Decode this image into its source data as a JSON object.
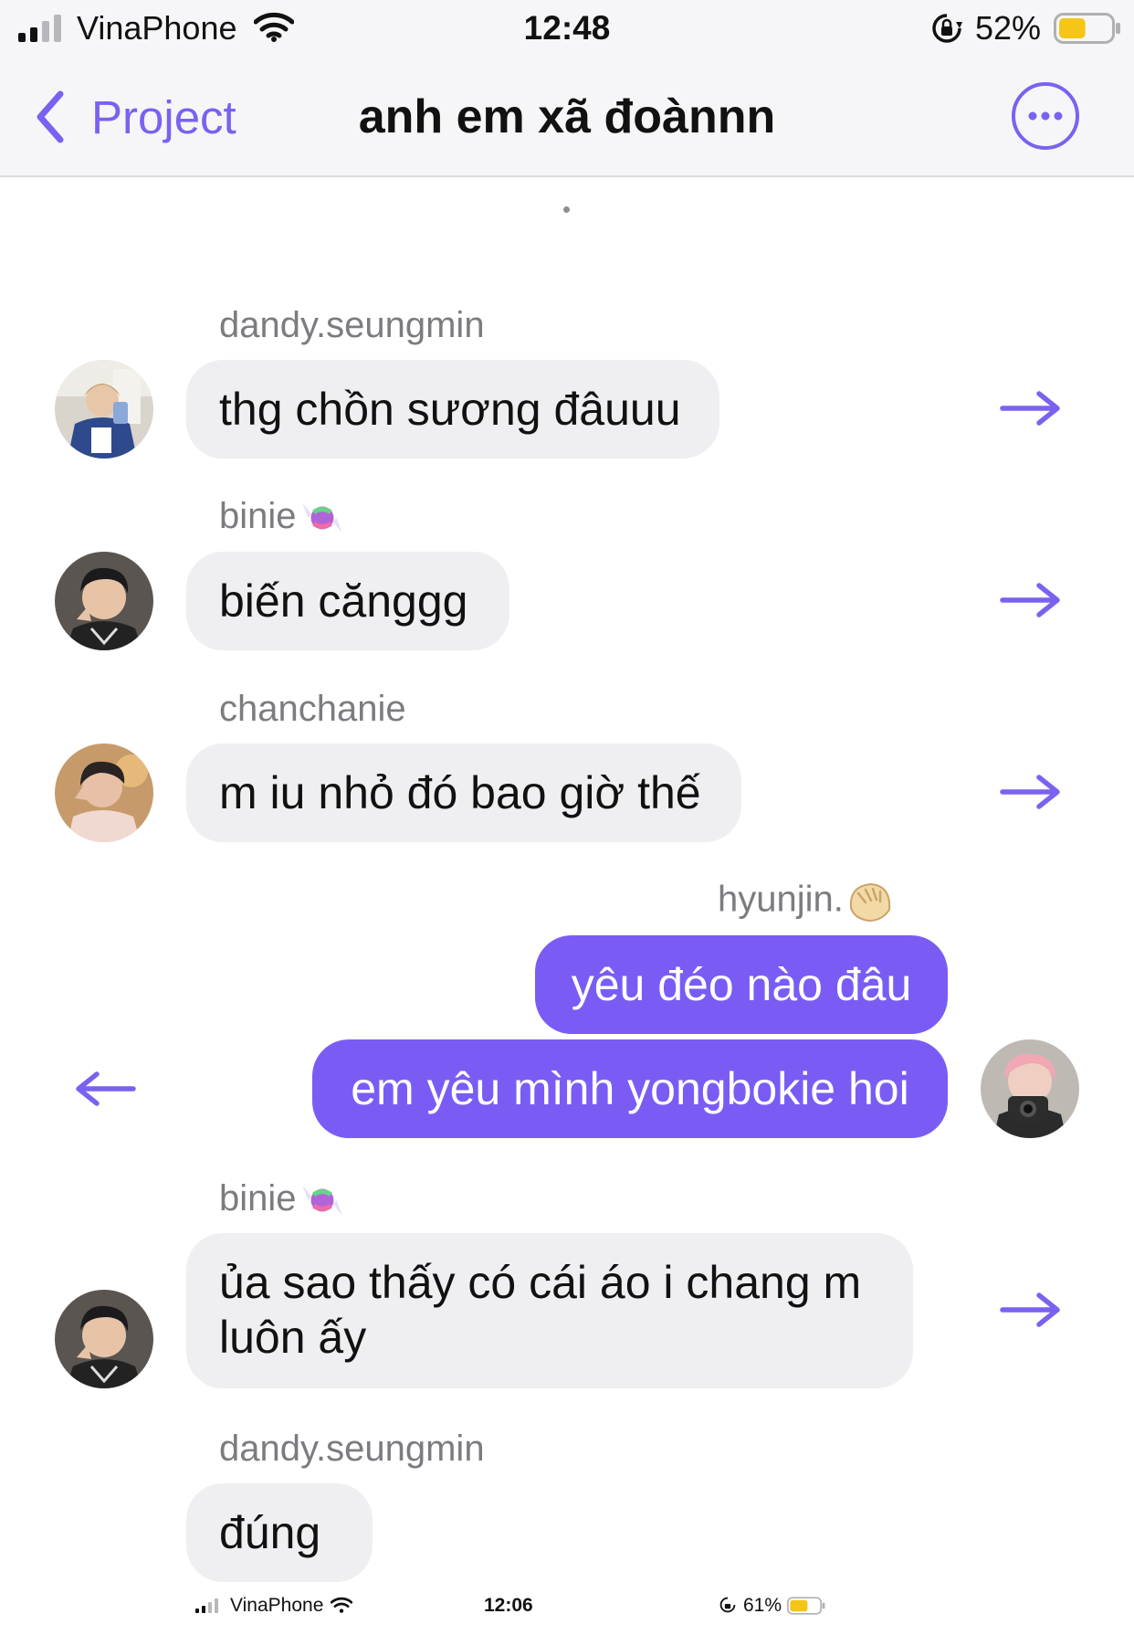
{
  "status_bar": {
    "carrier": "VinaPhone",
    "time": "12:48",
    "battery_percent": "52%",
    "battery_level": 0.52
  },
  "nav": {
    "back_label": "Project",
    "title": "anh em xã đoànnn"
  },
  "colors": {
    "accent": "#7a62f0",
    "outgoing_bubble": "#7a5cf5",
    "incoming_bubble": "#efeff2",
    "sender_text": "#7c7c80"
  },
  "messages": [
    {
      "sender": "dandy.seungmin",
      "text": "thg chồn sương đâuuu",
      "direction": "incoming"
    },
    {
      "sender": "binie",
      "sender_emoji": "candy",
      "text": "biến cănggg",
      "direction": "incoming"
    },
    {
      "sender": "chanchanie",
      "text": "m iu nhỏ đó bao giờ thế",
      "direction": "incoming"
    },
    {
      "sender": "hyunjin.",
      "sender_emoji": "dumpling",
      "texts": [
        "yêu đéo nào đâu",
        "em yêu mình yongbokie hoi"
      ],
      "direction": "outgoing"
    },
    {
      "sender": "binie",
      "sender_emoji": "candy",
      "text": "ủa sao thấy có cái áo i chang m luôn ấy",
      "direction": "incoming"
    },
    {
      "sender": "dandy.seungmin",
      "text": "đúng",
      "direction": "incoming"
    }
  ],
  "bottom_status_bar": {
    "carrier": "VinaPhone",
    "time": "12:06",
    "battery_percent": "61%",
    "battery_level": 0.61
  }
}
